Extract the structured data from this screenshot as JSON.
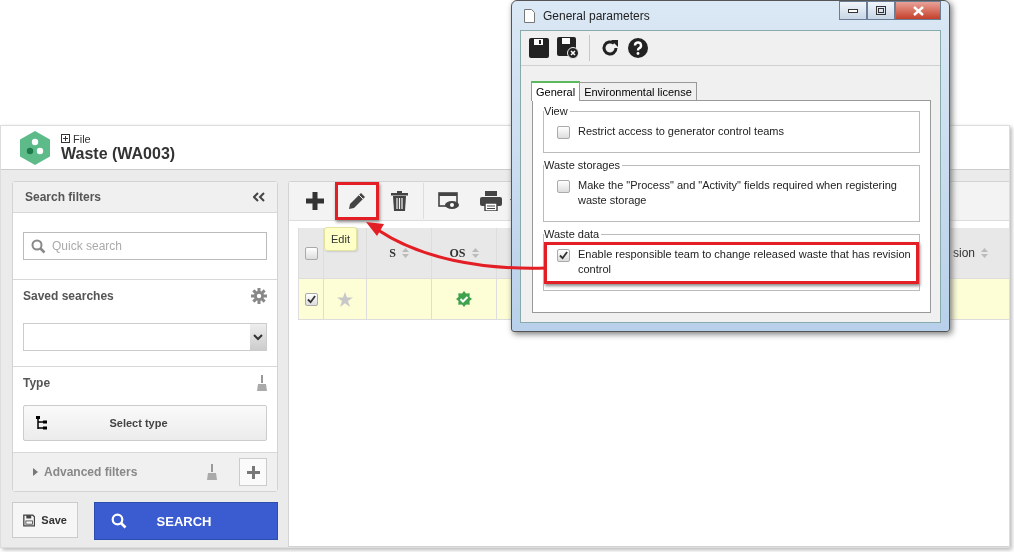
{
  "app": {
    "breadcrumb": "File",
    "title": "Waste (WA003)"
  },
  "filters": {
    "title": "Search filters",
    "quick_search": {
      "placeholder": "Quick search"
    },
    "saved_searches_label": "Saved searches",
    "type_label": "Type",
    "select_type": "Select type",
    "advanced": {
      "label": "Advanced filters",
      "expanded": false
    },
    "save": "Save",
    "search": "SEARCH"
  },
  "toolbar": {
    "buttons": [
      {
        "kind": "add",
        "highlighted": false
      },
      {
        "kind": "edit",
        "highlighted": true
      },
      {
        "kind": "delete",
        "highlighted": false
      },
      {
        "kind": "view",
        "highlighted": false
      },
      {
        "kind": "print",
        "highlighted": false
      }
    ],
    "tooltip": "Edit"
  },
  "table": {
    "select_all_checked": false,
    "columns": [
      {
        "label": "S"
      },
      {
        "label": "OS"
      },
      {
        "label": "sion"
      }
    ],
    "rows": [
      {
        "checked": true,
        "starred": false,
        "os_ok": true
      }
    ]
  },
  "dialog": {
    "title": "General parameters",
    "tabs": [
      {
        "label": "General",
        "selected": true
      },
      {
        "label": "Environmental license",
        "selected": false
      }
    ],
    "groups": [
      {
        "title": "View",
        "options": [
          {
            "label": "Restrict access to generator control teams",
            "checked": false,
            "highlighted": false
          }
        ]
      },
      {
        "title": "Waste storages",
        "options": [
          {
            "label": "Make the \"Process\" and \"Activity\" fields required when registering waste storage",
            "checked": false,
            "highlighted": false
          }
        ]
      },
      {
        "title": "Waste data",
        "options": [
          {
            "label": "Enable responsible team to change released waste that has revision control",
            "checked": true,
            "highlighted": true
          }
        ]
      }
    ]
  }
}
